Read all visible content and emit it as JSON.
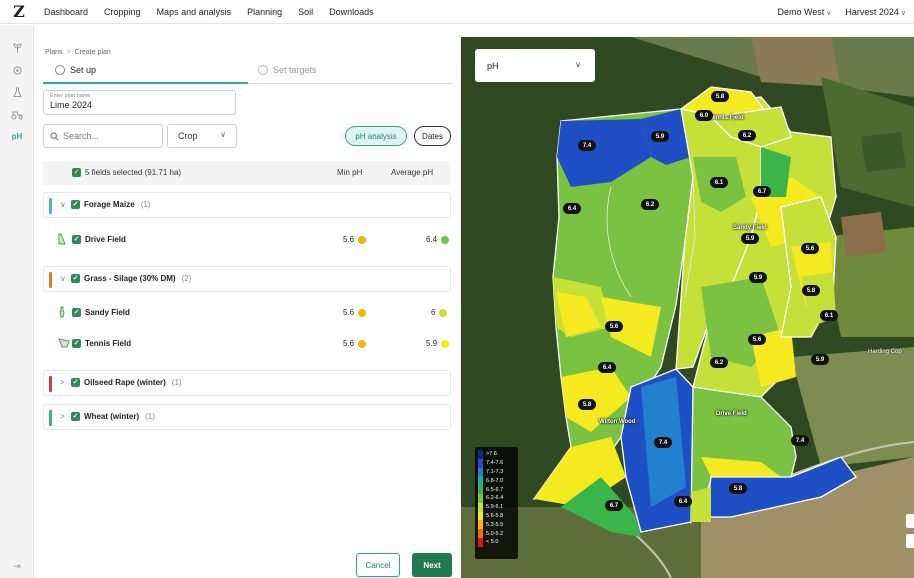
{
  "nav": {
    "logo": "Z",
    "items": [
      "Dashboard",
      "Cropping",
      "Maps and analysis",
      "Planning",
      "Soil",
      "Downloads"
    ],
    "farm": "Demo West",
    "harvest": "Harvest 2024"
  },
  "rail": {
    "ph_label": "pH",
    "collapse": "⇥"
  },
  "plan": {
    "breadcrumb": [
      "Plans",
      "Create plan"
    ],
    "steps": [
      "Set up",
      "Set targets"
    ],
    "name_label": "Enter plan name",
    "name_value": "Lime 2024",
    "search_placeholder": "Search...",
    "crop_filter": "Crop",
    "ph_analysis": "pH analysis",
    "dates": "Dates",
    "table": {
      "selected": "5 fields selected (91.71 ha)",
      "min_ph": "Min pH",
      "avg_ph": "Average pH"
    },
    "groups": [
      {
        "name": "Forage Maize",
        "count": "(1)",
        "color": "#4fb3d9",
        "caret": "∨",
        "fields": [
          {
            "name": "Drive Field",
            "min": "5.6",
            "min_color": "#f2b705",
            "avg": "6.4",
            "avg_color": "#7cc242"
          }
        ]
      },
      {
        "name": "Grass - Silage (30% DM)",
        "count": "(2)",
        "color": "#e07b2a",
        "caret": "∨",
        "fields": [
          {
            "name": "Sandy Field",
            "min": "5.6",
            "min_color": "#f2b705",
            "avg": "6",
            "avg_color": "#c6e03a"
          },
          {
            "name": "Tennis Field",
            "min": "5.6",
            "min_color": "#f2b705",
            "avg": "5.9",
            "avg_color": "#f5ea20"
          }
        ]
      },
      {
        "name": "Oilseed Rape (winter)",
        "count": "(1)",
        "color": "#d63b3b",
        "caret": ">",
        "fields": []
      },
      {
        "name": "Wheat (winter)",
        "count": "(1)",
        "color": "#3bb36b",
        "caret": ">",
        "fields": []
      }
    ],
    "cancel": "Cancel",
    "next": "Next"
  },
  "map": {
    "layer": "pH",
    "legend": [
      {
        "label": ">7.6",
        "color": "#0b2a8c"
      },
      {
        "label": "7.4-7.6",
        "color": "#1f4fc4"
      },
      {
        "label": "7.1-7.3",
        "color": "#2380cf"
      },
      {
        "label": "6.8-7.0",
        "color": "#26a8a0"
      },
      {
        "label": "6.5-6.7",
        "color": "#3bb54a"
      },
      {
        "label": "6.2-6.4",
        "color": "#7cc242"
      },
      {
        "label": "5.9-6.1",
        "color": "#c6e03a"
      },
      {
        "label": "5.6-5.8",
        "color": "#f5ea20"
      },
      {
        "label": "5.3-5.5",
        "color": "#f5b41c"
      },
      {
        "label": "5.0-5.2",
        "color": "#ef6a1c"
      },
      {
        "label": "< 5.0",
        "color": "#d7191c"
      }
    ],
    "badges": [
      "5.8",
      "6.0",
      "6.2",
      "7.4",
      "5.9",
      "6.1",
      "6.7",
      "6.4",
      "6.2",
      "5.9",
      "5.6",
      "5.9",
      "5.8",
      "6.1",
      "5.6",
      "5.9",
      "6.2",
      "5.6",
      "6.4",
      "5.8",
      "7.4",
      "5.8",
      "6.7",
      "6.4",
      "7.4"
    ],
    "field_labels": [
      "Tennis Field",
      "Sandy Field",
      "Drive Field",
      "Wilton Wood"
    ],
    "place_label": "Harding Cop"
  }
}
